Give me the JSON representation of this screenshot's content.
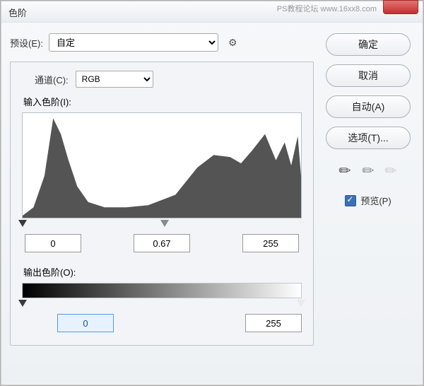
{
  "window": {
    "title": "色阶"
  },
  "watermark": "PS教程论坛   www.16xx8.com",
  "preset": {
    "label": "预设(E):",
    "value": "自定",
    "gear_icon": "gear-icon"
  },
  "channel": {
    "label": "通道(C):",
    "value": "RGB"
  },
  "input_levels": {
    "label": "输入色阶(I):",
    "shadow": "0",
    "midtone": "0.67",
    "highlight": "255"
  },
  "output_levels": {
    "label": "输出色阶(O):",
    "shadow": "0",
    "highlight": "255"
  },
  "buttons": {
    "ok": "确定",
    "cancel": "取消",
    "auto": "自动(A)",
    "options": "选项(T)..."
  },
  "preview": {
    "label": "预览(P)",
    "checked": true
  },
  "eyedroppers": {
    "black": "eyedropper-black-icon",
    "gray": "eyedropper-gray-icon",
    "white": "eyedropper-white-icon"
  },
  "chart_data": {
    "type": "area",
    "title": "",
    "xlabel": "",
    "ylabel": "",
    "xlim": [
      0,
      255
    ],
    "ylim": [
      0,
      100
    ],
    "x": [
      0,
      10,
      20,
      28,
      35,
      42,
      50,
      60,
      75,
      95,
      115,
      140,
      160,
      175,
      190,
      200,
      210,
      222,
      232,
      240,
      246,
      252,
      255
    ],
    "values": [
      2,
      10,
      40,
      95,
      80,
      55,
      30,
      15,
      10,
      10,
      12,
      22,
      48,
      60,
      58,
      52,
      64,
      80,
      55,
      72,
      50,
      78,
      40
    ],
    "fill_color": "#545454"
  }
}
